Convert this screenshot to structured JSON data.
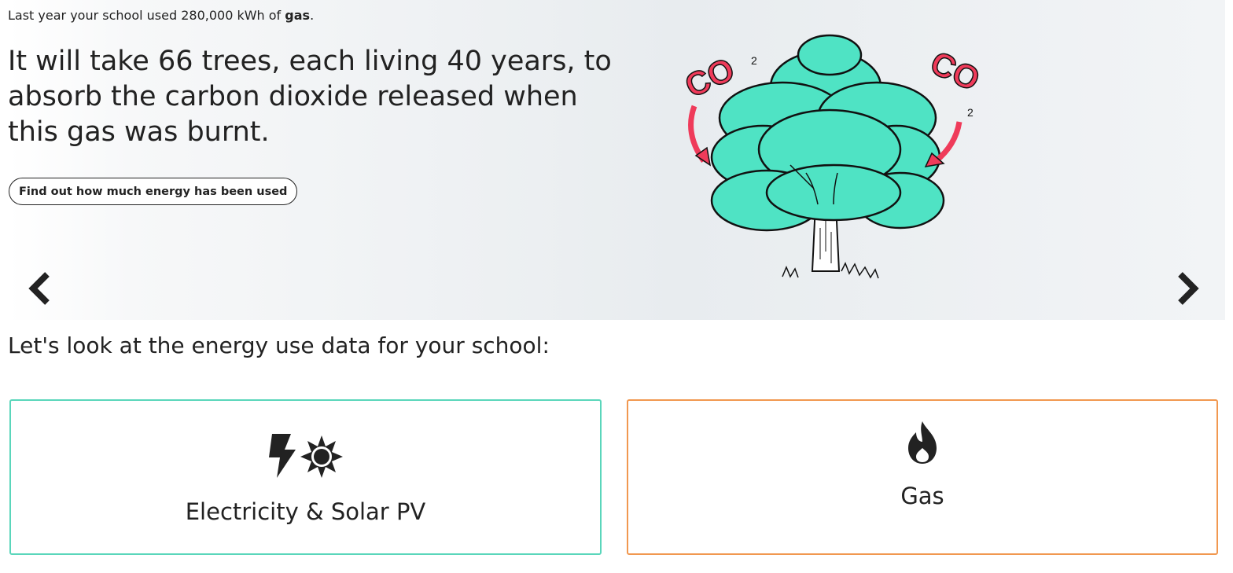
{
  "intro": {
    "prefix": "Last year your school used 280,000 kWh of ",
    "fuel": "gas",
    "suffix": "."
  },
  "headline": "It will take 66 trees, each living 40 years, to absorb the carbon dioxide released when this gas was burnt.",
  "cta_label": "Find out how much energy has been used",
  "tree_labels": {
    "left": "CO",
    "left_sub": "2",
    "right": "CO",
    "right_sub": "2"
  },
  "section_title": "Let's look at the energy use data for your school:",
  "cards": [
    {
      "label": "Electricity & Solar PV",
      "icons": [
        "bolt-icon",
        "sun-icon"
      ],
      "border_color": "#5ad6bb"
    },
    {
      "label": "Gas",
      "icons": [
        "flame-icon"
      ],
      "border_color": "#f19850"
    }
  ],
  "colors": {
    "tree_foliage": "#4fe3c4",
    "co2_arrows": "#ef3b5a",
    "text": "#222222"
  }
}
